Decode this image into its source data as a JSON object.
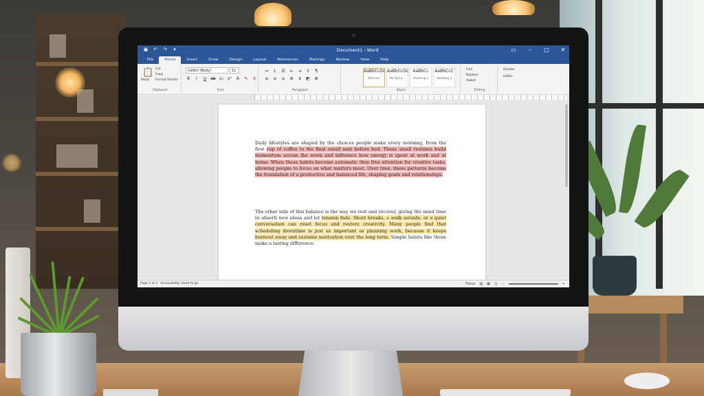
{
  "word": {
    "title": "Document1 - Word",
    "qat": [
      "save-icon",
      "undo-icon",
      "redo-icon",
      "customize-icon"
    ],
    "tabs": [
      "File",
      "Home",
      "Insert",
      "Draw",
      "Design",
      "Layout",
      "References",
      "Mailings",
      "Review",
      "View",
      "Help"
    ],
    "active_tab": "Home",
    "clipboard": {
      "paste": "Paste",
      "cut": "Cut",
      "copy": "Copy",
      "painter": "Format Painter",
      "label": "Clipboard"
    },
    "font": {
      "name": "Calibri (Body)",
      "size": "11",
      "label": "Font"
    },
    "paragraph": {
      "label": "Paragraph"
    },
    "styles": {
      "items": [
        {
          "preview": "AaBbCcDc",
          "name": "Normal"
        },
        {
          "preview": "AaBbCcDc",
          "name": "No Spac..."
        },
        {
          "preview": "AaBbCc",
          "name": "Heading 1"
        },
        {
          "preview": "AaBbCcC",
          "name": "Heading 2"
        }
      ],
      "label": "Styles"
    },
    "editing": {
      "find": "Find",
      "replace": "Replace",
      "select": "Select",
      "label": "Editing"
    },
    "dictate": {
      "dictate": "Dictate",
      "editor": "Editor"
    },
    "status": {
      "page": "Page 1 of 1",
      "words": "Accessibility: Good to go",
      "focus": "Focus"
    },
    "document": {
      "para1_plain": "Daily lifestyles are shaped by the choices people make every morning, from the first ",
      "para1_red": "cup of coffee to the final email sent before bed. These small routines build momentum across the week and influence how energy is spent at work and at home. When these habits become automatic they free attention for creative tasks, allowing people to focus on what matters most. Over time, these patterns become the foundation of a productive and balanced life, shaping goals and relationships.",
      "para2_plain": "The other side of this balance is the way we rest and recover, giving the mind time to absorb new ideas and let ",
      "para2_yel": "tension fade. Short breaks, a walk outside, or a quiet conversation can reset focus and restore creativity. Many people find that scheduling downtime is just as important as planning work, because it keeps burnout away and sustains motivation over the long term. ",
      "para2_tail": "Simple habits like these make a lasting difference."
    }
  }
}
